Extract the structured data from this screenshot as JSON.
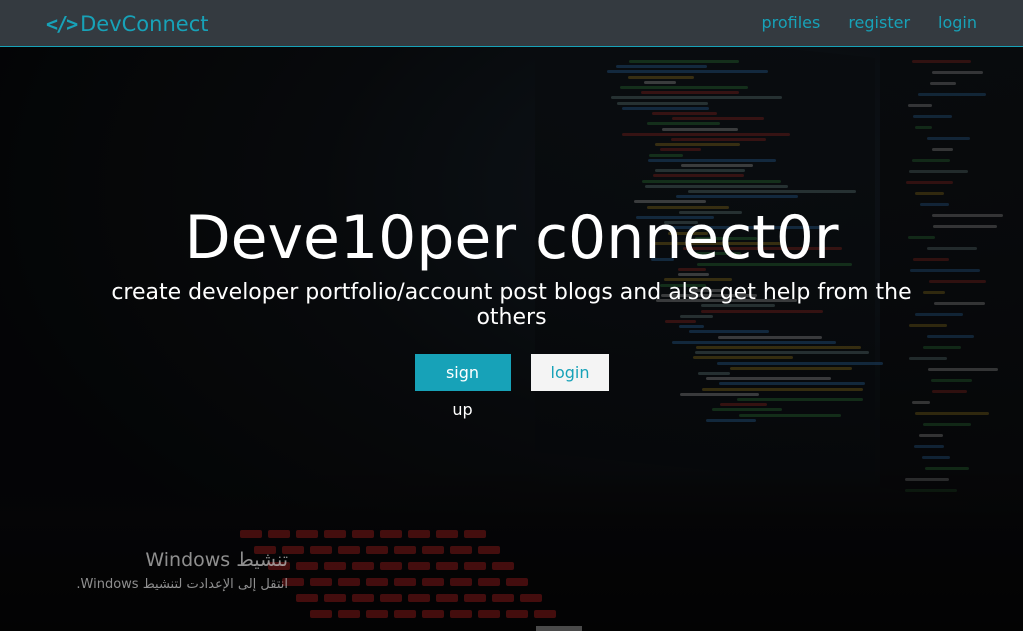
{
  "navbar": {
    "brand_icon": "</>",
    "brand_name": "DevConnect",
    "links": [
      {
        "label": "profiles"
      },
      {
        "label": "register"
      },
      {
        "label": "login"
      }
    ]
  },
  "hero": {
    "title": "Deve10per c0nnect0r",
    "subtitle": "create developer portfolio/account post blogs and also get help from the others",
    "buttons": {
      "signup_label": "sign up",
      "login_label": "login"
    }
  },
  "activation": {
    "title": "تنشيط Windows",
    "subtitle": "انتقل إلى الإعدادت لتنشيط Windows."
  },
  "colors": {
    "accent": "#17a2b8",
    "navbar_bg": "#343a40",
    "text_light": "#ffffff"
  },
  "icons": {
    "brand": "code-brackets-icon"
  }
}
